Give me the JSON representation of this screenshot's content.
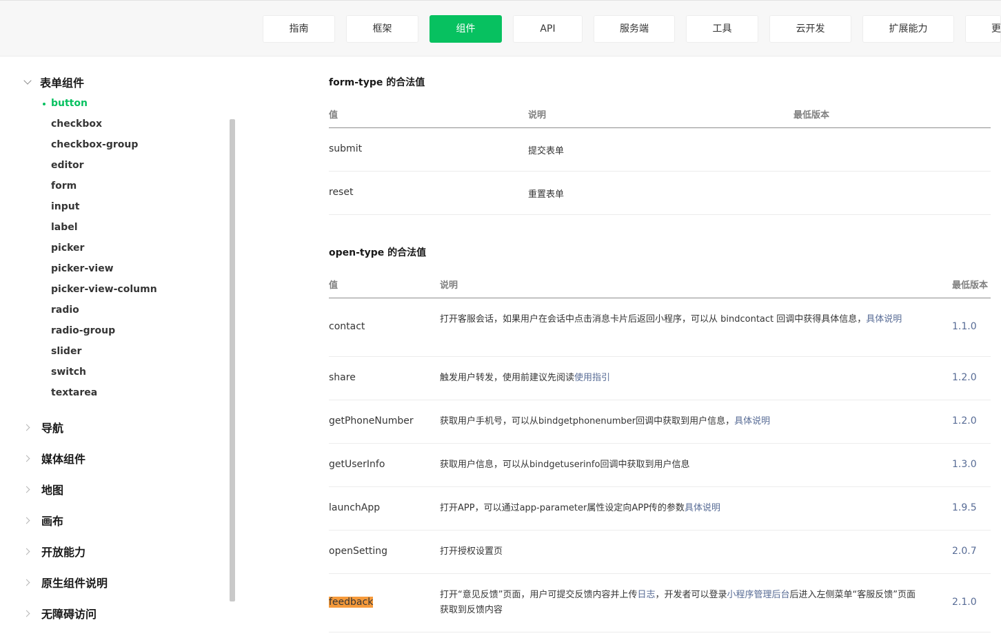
{
  "nav": {
    "tabs": [
      {
        "label": "指南"
      },
      {
        "label": "框架"
      },
      {
        "label": "组件"
      },
      {
        "label": "API"
      },
      {
        "label": "服务端"
      },
      {
        "label": "工具"
      },
      {
        "label": "云开发"
      },
      {
        "label": "扩展能力"
      },
      {
        "label": "更"
      }
    ],
    "active_color": "#07c160"
  },
  "sidebar": {
    "expanded_group": "表单组件",
    "items": [
      "button",
      "checkbox",
      "checkbox-group",
      "editor",
      "form",
      "input",
      "label",
      "picker",
      "picker-view",
      "picker-view-column",
      "radio",
      "radio-group",
      "slider",
      "switch",
      "textarea"
    ],
    "active_item": "button",
    "groups": [
      "导航",
      "媒体组件",
      "地图",
      "画布",
      "开放能力",
      "原生组件说明",
      "无障碍访问"
    ]
  },
  "form_type": {
    "title": "form-type 的合法值",
    "headers": [
      "值",
      "说明",
      "最低版本"
    ],
    "rows": [
      {
        "value": "submit",
        "desc": "提交表单"
      },
      {
        "value": "reset",
        "desc": "重置表单"
      }
    ]
  },
  "open_type": {
    "title": "open-type 的合法值",
    "headers": [
      "值",
      "说明",
      "最低版本"
    ],
    "rows": [
      {
        "value": "contact",
        "desc_a": "打开客服会话，如果用户在会话中点击消息卡片后返回小程序，可以从 bindcontact 回调中获得具体信息，",
        "desc_link": "具体说明",
        "version": "1.1.0"
      },
      {
        "value": "share",
        "desc_a": "触发用户转发，使用前建议先阅读",
        "desc_link": "使用指引",
        "version": "1.2.0"
      },
      {
        "value": "getPhoneNumber",
        "desc_a": "获取用户手机号，可以从bindgetphonenumber回调中获取到用户信息，",
        "desc_link": "具体说明",
        "version": "1.2.0"
      },
      {
        "value": "getUserInfo",
        "desc_a": "获取用户信息，可以从bindgetuserinfo回调中获取到用户信息",
        "version": "1.3.0"
      },
      {
        "value": "launchApp",
        "desc_a": "打开APP，可以通过app-parameter属性设定向APP传的参数",
        "desc_link": "具体说明",
        "version": "1.9.5"
      },
      {
        "value": "openSetting",
        "desc_a": "打开授权设置页",
        "version": "2.0.7"
      },
      {
        "value": "feedback",
        "desc_a": "打开“意见反馈”页面，用户可提交反馈内容并上传",
        "desc_link": "日志",
        "desc_b": "，开发者可以登录",
        "desc_link2": "小程序管理后台",
        "desc_c": "后进入左侧菜单“客服反馈”页面获取到反馈内容",
        "version": "2.1.0"
      }
    ]
  },
  "colors": {
    "accent": "#07c160",
    "link": "#576b95",
    "highlight": "#f59a3b"
  }
}
